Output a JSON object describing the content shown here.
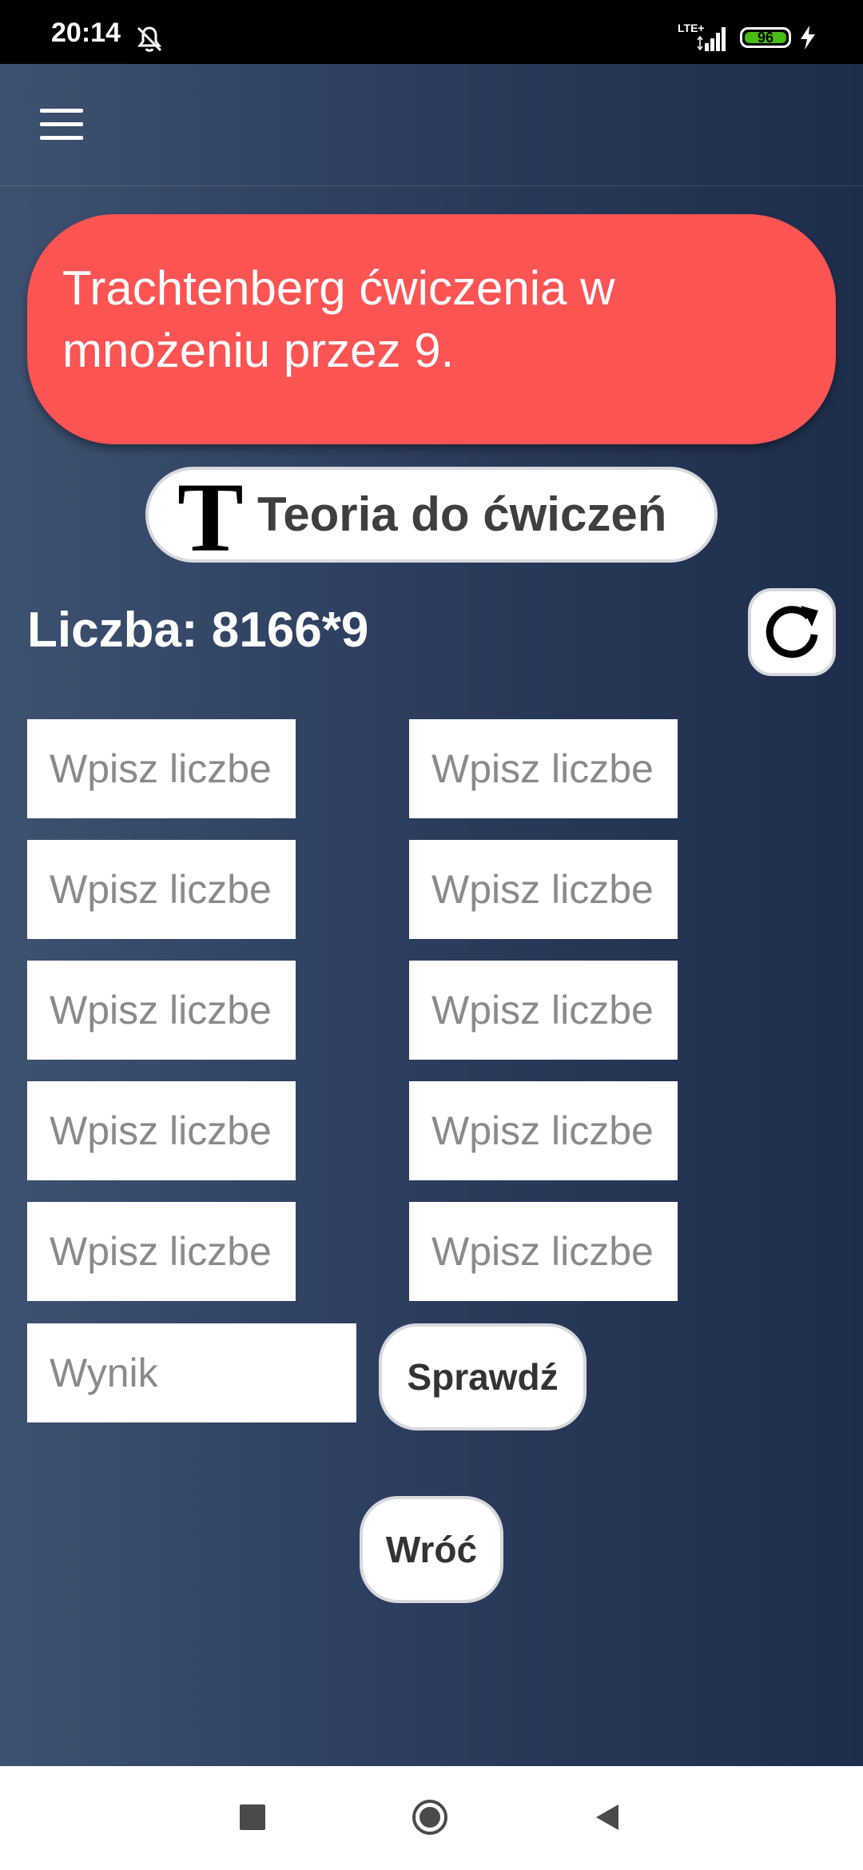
{
  "status_bar": {
    "time": "20:14",
    "network": "LTE+",
    "battery_level": "96",
    "icons": [
      "mute-icon",
      "signal-icon",
      "battery-icon",
      "charging-icon"
    ]
  },
  "toolbar": {
    "menu_icon": "hamburger-menu-icon"
  },
  "header": {
    "title": "Trachtenberg ćwiczenia w mnożeniu przez 9."
  },
  "theory_button": {
    "glyph": "T",
    "label": "Teoria do ćwiczeń"
  },
  "exercise": {
    "number_label": "Liczba: 8166*9"
  },
  "inputs": {
    "placeholder": "Wpisz liczbe",
    "result_placeholder": "Wynik"
  },
  "actions": {
    "check_label": "Sprawdź",
    "back_label": "Wróć"
  },
  "colors": {
    "title_card": "#fc5353",
    "background_start": "#3d5170",
    "background_end": "#1e2d4b"
  }
}
